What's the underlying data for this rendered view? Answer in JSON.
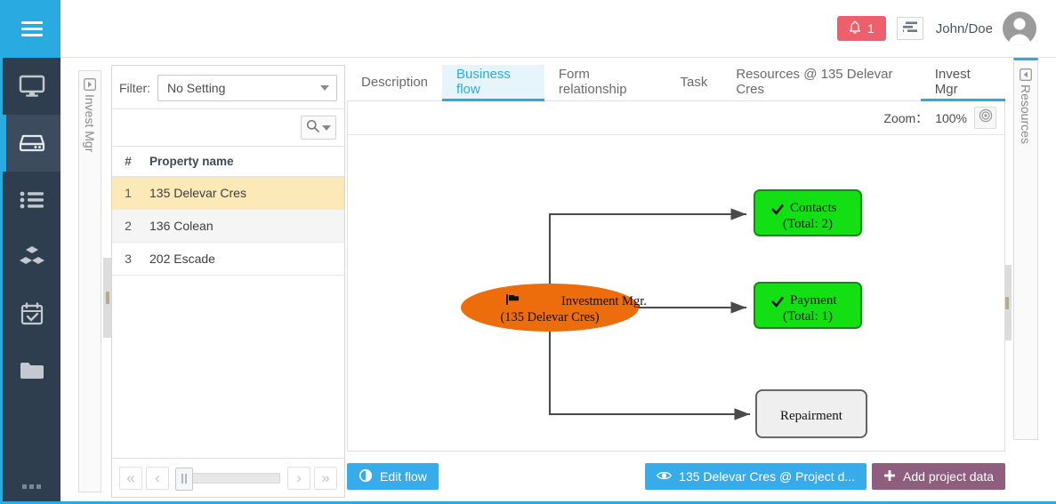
{
  "colors": {
    "accent": "#29abe2",
    "rail_bg": "#2f3e4f",
    "rail_active": "#3c4c5e",
    "badge_red": "#ec5f6b",
    "btn_blue": "#38acea",
    "btn_purple": "#8f5d7e",
    "node_green": "#12e012",
    "node_green_border": "#0f8f0f",
    "ellipse_orange": "#ed6c0b",
    "row_selected": "#fbe9b7"
  },
  "rail": {
    "menu_icon": "hamburger-icon",
    "items": [
      {
        "icon": "monitor-icon",
        "label": "Dashboard",
        "active": false
      },
      {
        "icon": "server-icon",
        "label": "Data",
        "active": true
      },
      {
        "icon": "list-icon",
        "label": "Lists",
        "active": false
      },
      {
        "icon": "cubes-icon",
        "label": "Modules",
        "active": false
      },
      {
        "icon": "calendar-check-icon",
        "label": "Schedule",
        "active": false
      },
      {
        "icon": "folder-icon",
        "label": "Files",
        "active": false
      }
    ],
    "more_icon": "ellipsis-icon"
  },
  "header": {
    "notification_icon": "bell-icon",
    "notification_count": "1",
    "menu_button_icon": "list-settings-icon",
    "user_name": "John/Doe",
    "avatar_icon": "user-avatar"
  },
  "left_vtab": {
    "icon": "expand-right-icon",
    "label": "Invest Mgr"
  },
  "right_vtab": {
    "icon": "collapse-left-icon",
    "label": "Resources"
  },
  "list_panel": {
    "filter_label": "Filter:",
    "filter_value": "No Setting",
    "filter_caret": "chevron-down-icon",
    "search_icon": "search-icon",
    "search_caret": "chevron-down-icon",
    "columns": [
      "#",
      "Property name"
    ],
    "rows": [
      {
        "num": "1",
        "name": "135 Delevar Cres",
        "selected": true
      },
      {
        "num": "2",
        "name": "136 Colean",
        "selected": false
      },
      {
        "num": "3",
        "name": "202 Escade",
        "selected": false
      }
    ],
    "pager": {
      "first": "«",
      "prev": "‹",
      "next": "›",
      "last": "»"
    }
  },
  "tabs": [
    {
      "label": "Description",
      "state": "normal"
    },
    {
      "label": "Business flow",
      "state": "active"
    },
    {
      "label": "Form relationship",
      "state": "normal"
    },
    {
      "label": "Task",
      "state": "normal"
    },
    {
      "label": "Resources @ 135 Delevar Cres",
      "state": "normal"
    },
    {
      "label": "Invest Mgr",
      "state": "underline"
    }
  ],
  "zoom_bar": {
    "label": "Zoom：",
    "value": "100%",
    "reset_icon": "target-icon"
  },
  "chart_data": {
    "type": "diagram",
    "title": "Business flow",
    "nodes": [
      {
        "id": "root",
        "shape": "ellipse",
        "icon": "flag-icon",
        "line1": "Investment Mgr.",
        "line2": "(135 Delevar Cres)",
        "fill": "#ed6c0b",
        "text_color": "#000000"
      },
      {
        "id": "contacts",
        "shape": "rounded-rect",
        "icon": "check-icon",
        "line1": "Contacts",
        "line2": "(Total: 2)",
        "fill": "#12e012",
        "text_color": "#000000"
      },
      {
        "id": "payment",
        "shape": "rounded-rect",
        "icon": "check-icon",
        "line1": "Payment",
        "line2": "(Total: 1)",
        "fill": "#12e012",
        "text_color": "#000000"
      },
      {
        "id": "repairment",
        "shape": "rounded-rect",
        "icon": "",
        "line1": "Repairment",
        "line2": "",
        "fill": "#eeeeee",
        "text_color": "#000000"
      }
    ],
    "edges": [
      {
        "from": "root",
        "to": "contacts"
      },
      {
        "from": "root",
        "to": "payment"
      },
      {
        "from": "root",
        "to": "repairment"
      }
    ]
  },
  "footer": {
    "edit_flow": {
      "label": "Edit flow",
      "icon": "contrast-icon"
    },
    "project_link": {
      "label": "135 Delevar Cres @ Project d...",
      "icon": "eye-icon"
    },
    "add_data": {
      "label": "Add project data",
      "icon": "plus-icon"
    }
  }
}
